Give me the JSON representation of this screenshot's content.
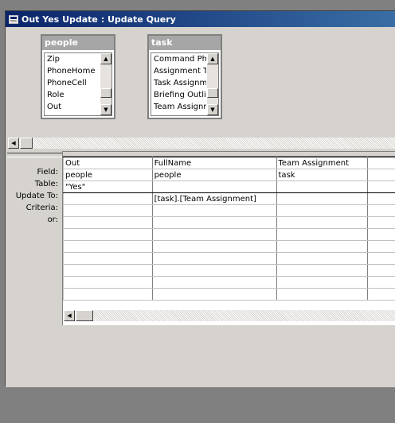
{
  "window": {
    "title": "Out Yes Update : Update Query"
  },
  "tables": [
    {
      "name": "people",
      "fields": [
        "Zip",
        "PhoneHome",
        "PhoneCell",
        "Role",
        "Out"
      ]
    },
    {
      "name": "task",
      "fields": [
        "Command Pho",
        "Assignment Ty",
        "Task Assignme",
        "Briefing Outlin",
        "Team Assignm"
      ]
    }
  ],
  "grid": {
    "row_labels": [
      "Field:",
      "Table:",
      "Update To:",
      "Criteria:",
      "or:"
    ],
    "columns": [
      {
        "field": "Out",
        "table": "people",
        "update_to": "\"Yes\"",
        "criteria": ""
      },
      {
        "field": "FullName",
        "table": "people",
        "update_to": "",
        "criteria": "[task].[Team Assignment]"
      },
      {
        "field": "Team Assignment",
        "table": "task",
        "update_to": "",
        "criteria": ""
      },
      {
        "field": "",
        "table": "",
        "update_to": "",
        "criteria": ""
      }
    ]
  },
  "icons": {
    "scroll_up": "triangle-up-icon",
    "scroll_down": "triangle-down-icon",
    "scroll_left": "triangle-left-icon"
  }
}
